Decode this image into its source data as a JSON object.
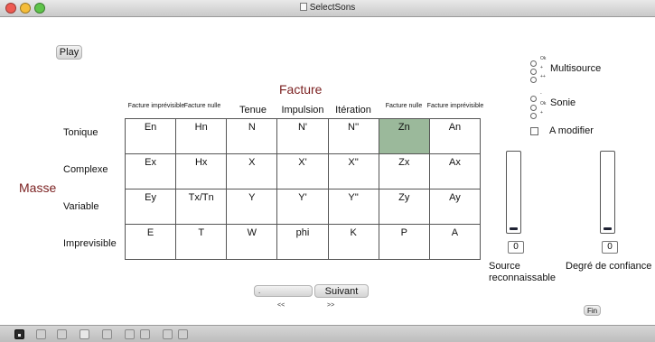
{
  "window": {
    "title": "SelectSons"
  },
  "buttons": {
    "play": "Play",
    "prev": ".",
    "next": "Suivant",
    "fin": "Fin"
  },
  "nav": {
    "prev_arrows": "<<",
    "next_arrows": ">>"
  },
  "facture": {
    "title": "Facture",
    "columns": [
      "Facture imprévisible",
      "Facture nulle",
      "Tenue",
      "Impulsion",
      "Itération",
      "Facture nulle",
      "Facture imprévisible"
    ]
  },
  "masse": {
    "title": "Masse",
    "rows": [
      "Tonique",
      "Complexe",
      "Variable",
      "Imprevisible"
    ]
  },
  "grid": {
    "rows": [
      [
        "En",
        "Hn",
        "N",
        "N'",
        "N''",
        "Zn",
        "An"
      ],
      [
        "Ex",
        "Hx",
        "X",
        "X'",
        "X''",
        "Zx",
        "Ax"
      ],
      [
        "Ey",
        "Tx/Tn",
        "Y",
        "Y'",
        "Y''",
        "Zy",
        "Ay"
      ],
      [
        "E",
        "T",
        "W",
        "phi",
        "K",
        "P",
        "A"
      ]
    ],
    "selected": "Zn",
    "selected_color": "#9bb99b"
  },
  "multisource": {
    "label": "Multisource",
    "options": [
      "Ok",
      "+",
      "++"
    ]
  },
  "sonie": {
    "label": "Sonie",
    "options": [
      "-",
      "Ok",
      "+"
    ]
  },
  "modify": {
    "label": "A modifier",
    "checked": false
  },
  "sliders": {
    "source": {
      "value": "0",
      "label_line1": "Source",
      "label_line2": "reconnaissable"
    },
    "confidence": {
      "value": "0",
      "label": "Degré de confiance"
    }
  },
  "footer": {
    "icons": [
      "lock-icon",
      "add-object-icon",
      "add-subpatch-icon",
      "presentation-icon",
      "info-icon",
      "window-icon",
      "window-icon",
      "grid-icon",
      "grid-icon"
    ]
  }
}
